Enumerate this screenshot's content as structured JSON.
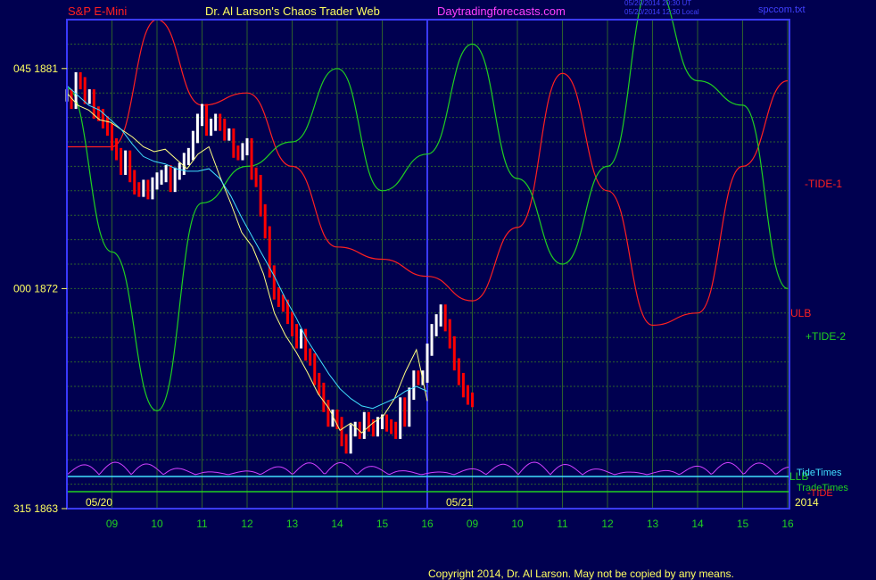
{
  "header": {
    "instrument": "S&P E-Mini",
    "site_title": "Dr. Al Larson's Chaos Trader Web",
    "site_url": "Daytradingforecasts.com",
    "timestamp_ut": "05/20/2014 20:30 UT",
    "timestamp_local": "05/20/2014 12:30 Local",
    "file_name": "spccom.txt"
  },
  "footer": {
    "copyright": "Copyright 2014, Dr. Al Larson. May not be copied by any means."
  },
  "colors": {
    "background": "#000050",
    "frame": "#3a3aff",
    "grid": "#2c5f2c",
    "price_up": "#ffffff",
    "price_down": "#ff0000",
    "fast_ma": "#ffff80",
    "slow_ma": "#40e0ff",
    "tide_minus": "#ff2020",
    "tide_plus": "#20d020",
    "chaos_clock": "#d040ff",
    "tide_times": "#40e0ff",
    "trade_times": "#20d020"
  },
  "chart_data": {
    "type": "line",
    "title": "S&P E-Mini",
    "xlabel": "",
    "ylabel": "",
    "ylim": [
      1863,
      1883
    ],
    "grid": true,
    "date_labels": [
      {
        "label": "05/20",
        "day": "05/20",
        "hour": 8.5
      },
      {
        "label": "05/21",
        "day": "05/21",
        "hour": 8.5
      }
    ],
    "year_label": "2014",
    "x_ticks": [
      {
        "day": "05/20",
        "hour": 9,
        "label": "09"
      },
      {
        "day": "05/20",
        "hour": 10,
        "label": "10"
      },
      {
        "day": "05/20",
        "hour": 11,
        "label": "11"
      },
      {
        "day": "05/20",
        "hour": 12,
        "label": "12"
      },
      {
        "day": "05/20",
        "hour": 13,
        "label": "13"
      },
      {
        "day": "05/20",
        "hour": 14,
        "label": "14"
      },
      {
        "day": "05/20",
        "hour": 15,
        "label": "15"
      },
      {
        "day": "05/20",
        "hour": 16,
        "label": "16"
      },
      {
        "day": "05/21",
        "hour": 9,
        "label": "09"
      },
      {
        "day": "05/21",
        "hour": 10,
        "label": "10"
      },
      {
        "day": "05/21",
        "hour": 11,
        "label": "11"
      },
      {
        "day": "05/21",
        "hour": 12,
        "label": "12"
      },
      {
        "day": "05/21",
        "hour": 13,
        "label": "13"
      },
      {
        "day": "05/21",
        "hour": 14,
        "label": "14"
      },
      {
        "day": "05/21",
        "hour": 15,
        "label": "15"
      },
      {
        "day": "05/21",
        "hour": 16,
        "label": "16"
      }
    ],
    "y_ticks": [
      {
        "value": 1881,
        "label": "045  1881"
      },
      {
        "value": 1872,
        "label": "000  1872"
      },
      {
        "value": 1863,
        "label": "315  1863"
      }
    ],
    "series": [
      {
        "name": "S&P E-Mini",
        "kind": "price",
        "day": "05/20",
        "start_hour": 8.0,
        "interval_hours": 0.1,
        "values": [
          1879.9,
          1879.6,
          1880.6,
          1880.4,
          1879.8,
          1879.9,
          1879.2,
          1879.1,
          1878.8,
          1878.5,
          1877.9,
          1877.5,
          1876.9,
          1877.4,
          1876.6,
          1876.1,
          1876.0,
          1876.2,
          1875.9,
          1876.3,
          1876.5,
          1876.6,
          1876.8,
          1876.2,
          1876.7,
          1876.9,
          1877.3,
          1877.5,
          1878.2,
          1878.9,
          1879.3,
          1878.5,
          1878.7,
          1878.9,
          1878.7,
          1878.3,
          1878.3,
          1877.6,
          1877.5,
          1877.7,
          1877.9,
          1876.7,
          1876.4,
          1875.2,
          1874.3,
          1872.7,
          1871.8,
          1871.5,
          1871.3,
          1870.8,
          1870.3,
          1869.8,
          1870.1,
          1869.3,
          1869.1,
          1868.3,
          1867.9,
          1867.2,
          1866.6,
          1866.8,
          1866.5,
          1865.8,
          1865.5,
          1866.2,
          1866.3,
          1866.1,
          1866.7,
          1866.4,
          1866.2,
          1866.5,
          1866.6,
          1866.4,
          1866.3,
          1866.1,
          1867.3,
          1866.6,
          1867.7,
          1868.4,
          1868.3,
          1868.4,
          1869.5,
          1870.3,
          1870.7,
          1871.1,
          1870.5,
          1869.8,
          1868.9,
          1868.3,
          1867.8,
          1867.5,
          1867.4
        ]
      },
      {
        "name": "Fast MA",
        "kind": "fast_ma",
        "day": "05/20",
        "start_hour": 8.0,
        "interval_hours": 0.1,
        "values": [
          1880.0,
          1879.5,
          1879.3,
          1878.9,
          1878.8,
          1878.5,
          1878.2,
          1877.8,
          1877.6,
          1877.7,
          1877.3,
          1876.9,
          1877.5,
          1877.8,
          1876.6,
          1875.5,
          1874.3,
          1873.7,
          1872.6,
          1871.0,
          1870.1,
          1869.4,
          1868.6,
          1867.7,
          1867.1,
          1866.2,
          1866.5,
          1866.1,
          1866.5,
          1866.8,
          1867.5,
          1868.6,
          1869.5,
          1867.4
        ]
      },
      {
        "name": "Slow MA",
        "kind": "slow_ma",
        "day": "05/20",
        "start_hour": 8.0,
        "interval_hours": 0.1,
        "values": [
          1880.3,
          1879.9,
          1879.5,
          1879.3,
          1878.9,
          1878.5,
          1877.9,
          1877.4,
          1877.2,
          1877.1,
          1876.9,
          1876.8,
          1876.8,
          1876.9,
          1876.5,
          1875.8,
          1874.9,
          1874.1,
          1873.3,
          1872.5,
          1871.6,
          1870.8,
          1869.9,
          1869.2,
          1868.5,
          1867.9,
          1867.5,
          1867.2,
          1867.1,
          1867.3,
          1867.5,
          1867.8,
          1868.0,
          1867.8
        ]
      },
      {
        "name": "-TIDE-1",
        "kind": "tide_minus",
        "start_hour": 8.0,
        "interval_hours": 1.0,
        "values": [
          1877.8,
          1877.8,
          1883.0,
          1879.5,
          1880.0,
          1877.0,
          1873.7,
          1873.2,
          1872.5,
          1871.5,
          1874.5,
          1880.8,
          1876.0,
          1870.5,
          1871.0,
          1877.0,
          1880.5
        ]
      },
      {
        "name": "+TIDE-2",
        "kind": "tide_plus",
        "start_hour": 8.0,
        "interval_hours": 1.0,
        "values": [
          1880.2,
          1873.5,
          1867.0,
          1875.5,
          1877.0,
          1878.0,
          1881.0,
          1876.0,
          1877.5,
          1882.0,
          1876.5,
          1873.0,
          1877.0,
          1884.5,
          1880.5,
          1879.5,
          1872.0
        ]
      }
    ],
    "annotations": {
      "tide_minus_label": "-TIDE-1",
      "ulb_label": "ULB",
      "tide_plus_label": "+TIDE-2",
      "tide_times_label": "TideTimes",
      "trade_times_label": "TradeTimes",
      "llb_label": "LLB",
      "tide_label": "-TIDE"
    }
  }
}
